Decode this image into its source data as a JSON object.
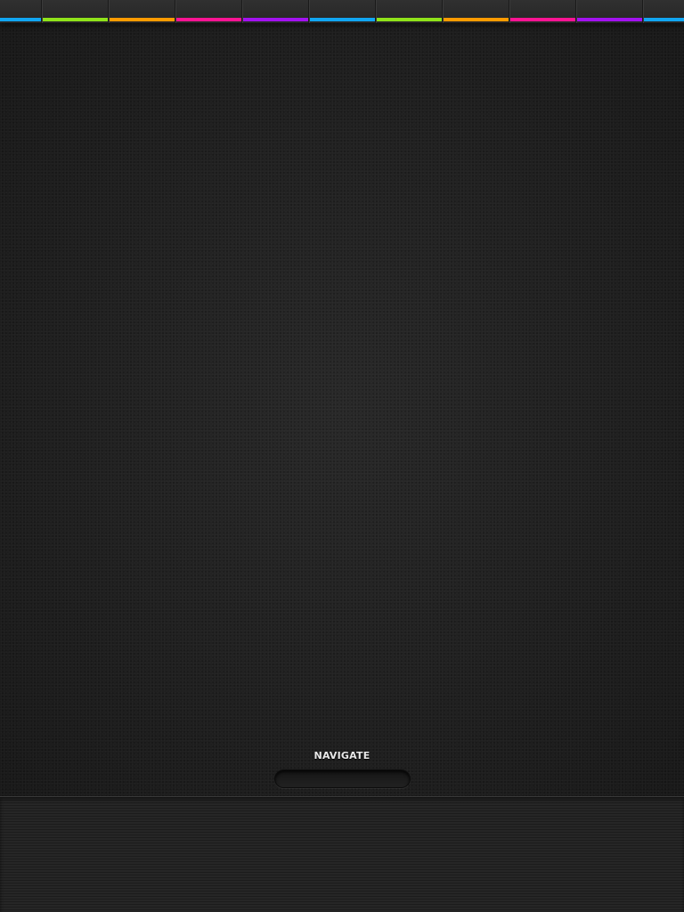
{
  "tabs": [
    {
      "id": "tab-1",
      "color": "#11a6f2"
    },
    {
      "id": "tab-2",
      "color": "#8fe31a"
    },
    {
      "id": "tab-3",
      "color": "#ff9b00"
    },
    {
      "id": "tab-4",
      "color": "#ff1493"
    },
    {
      "id": "tab-5",
      "color": "#a312f0"
    },
    {
      "id": "tab-6",
      "color": "#11a6f2"
    },
    {
      "id": "tab-7",
      "color": "#8fe31a"
    },
    {
      "id": "tab-8",
      "color": "#ff9b00"
    },
    {
      "id": "tab-9",
      "color": "#ff1493"
    },
    {
      "id": "tab-10",
      "color": "#a312f0"
    },
    {
      "id": "tab-11",
      "color": "#11a6f2"
    }
  ],
  "navigation": {
    "label": "NAVIGATE"
  },
  "colors": {
    "background": "#222222",
    "tab_strip": "#2b2b2b",
    "bottom_panel": "#262626"
  }
}
